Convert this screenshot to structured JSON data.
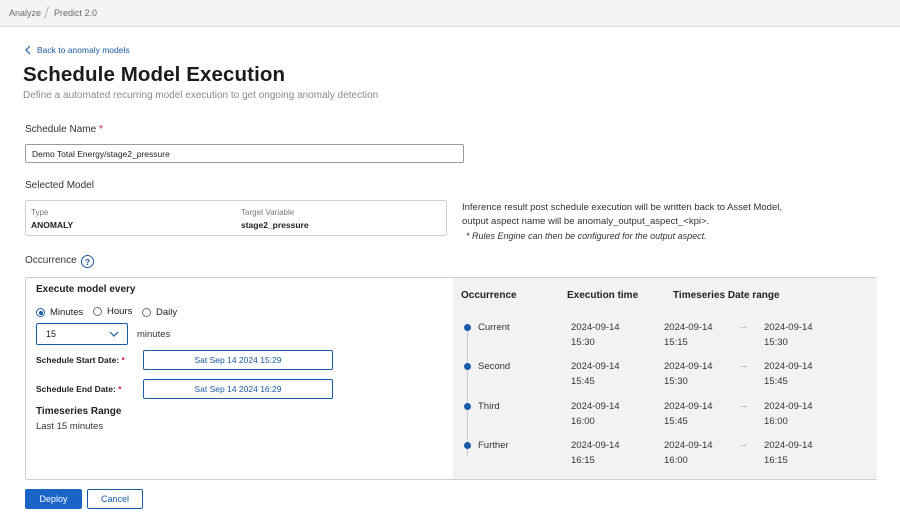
{
  "breadcrumb": [
    "Analyze",
    "Predict 2.0"
  ],
  "back_link": "Back to anomaly models",
  "page_title": "Schedule Model Execution",
  "page_subtitle": "Define a automated recurring model execution to get ongoing anomaly detection",
  "schedule_name": {
    "label": "Schedule Name",
    "required_mark": "*",
    "value": "Demo Total Energy/stage2_pressure"
  },
  "selected_model": {
    "label": "Selected Model",
    "type_key": "Type",
    "type_value": "ANOMALY",
    "target_key": "Target Variable",
    "target_value": "stage2_pressure"
  },
  "inference_info": {
    "line1": "Inference result post schedule execution will be written back to Asset Model,",
    "line2": "output aspect name will be anomaly_output_aspect_<kpi>.",
    "note": "* Rules Engine can then be configured for the output aspect."
  },
  "occurrence": {
    "label": "Occurrence",
    "help_icon": "?",
    "execute_title": "Execute model every",
    "options": [
      {
        "label": "Minutes",
        "selected": true
      },
      {
        "label": "Hours",
        "selected": false
      },
      {
        "label": "Daily",
        "selected": false
      }
    ],
    "interval_value": "15",
    "interval_unit": "minutes",
    "start_label": "Schedule Start Date:",
    "start_value": "Sat Sep 14 2024 15:29",
    "end_label": "Schedule End Date:",
    "end_value": "Sat Sep 14 2024 16:29",
    "required_mark": "*",
    "range_title": "Timeseries Range",
    "range_value": "Last 15 minutes"
  },
  "preview": {
    "headers": [
      "Occurrence",
      "Execution time",
      "Timeseries Date range"
    ],
    "rows": [
      {
        "name": "Current",
        "exec_date": "2024-09-14",
        "exec_time": "15:30",
        "from_date": "2024-09-14",
        "from_time": "15:15",
        "to_date": "2024-09-14",
        "to_time": "15:30"
      },
      {
        "name": "Second",
        "exec_date": "2024-09-14",
        "exec_time": "15:45",
        "from_date": "2024-09-14",
        "from_time": "15:30",
        "to_date": "2024-09-14",
        "to_time": "15:45"
      },
      {
        "name": "Third",
        "exec_date": "2024-09-14",
        "exec_time": "16:00",
        "from_date": "2024-09-14",
        "from_time": "15:45",
        "to_date": "2024-09-14",
        "to_time": "16:00"
      },
      {
        "name": "Further",
        "exec_date": "2024-09-14",
        "exec_time": "16:15",
        "from_date": "2024-09-14",
        "from_time": "16:00",
        "to_date": "2024-09-14",
        "to_time": "16:15"
      }
    ],
    "arrow_glyph": "→"
  },
  "actions": {
    "deploy_label": "Deploy",
    "cancel_label": "Cancel"
  },
  "colors": {
    "accent": "#1a5aa6",
    "primary_button": "#1a64c8",
    "required": "#d0184c",
    "preview_bg": "#f1f2f3"
  }
}
